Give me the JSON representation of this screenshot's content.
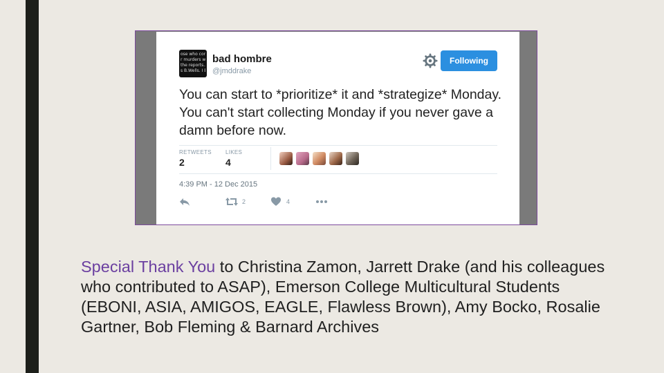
{
  "colors": {
    "background": "#ece9e3",
    "left_bar": "#1d1f1a",
    "accent": "#6b3fa0",
    "follow_button": "#2b8fe0"
  },
  "tweet": {
    "avatar_text": [
      "ose who com",
      "r murders wi",
      "the reports...",
      "s B.Wells. I B"
    ],
    "display_name": "bad hombre",
    "handle": "@jmddrake",
    "follow_label": "Following",
    "text": "You can start to *prioritize* it and *strategize* Monday. You can't start collecting Monday if you never gave a damn before now.",
    "retweets_label": "RETWEETS",
    "retweets_value": "2",
    "likes_label": "LIKES",
    "likes_value": "4",
    "timestamp": "4:39 PM - 12 Dec 2015",
    "action_retweet_count": "2",
    "action_like_count": "4",
    "icons": [
      "settings-gear-icon",
      "reply-icon",
      "retweet-icon",
      "like-heart-icon",
      "more-dots-icon"
    ]
  },
  "caption": {
    "highlight": "Special Thank You",
    "rest": " to Christina Zamon, Jarrett Drake (and his colleagues who contributed to ASAP), Emerson College Multicultural Students (EBONI, ASIA, AMIGOS, EAGLE, Flawless Brown), Amy Bocko, Rosalie Gartner, Bob Fleming & Barnard Archives"
  }
}
